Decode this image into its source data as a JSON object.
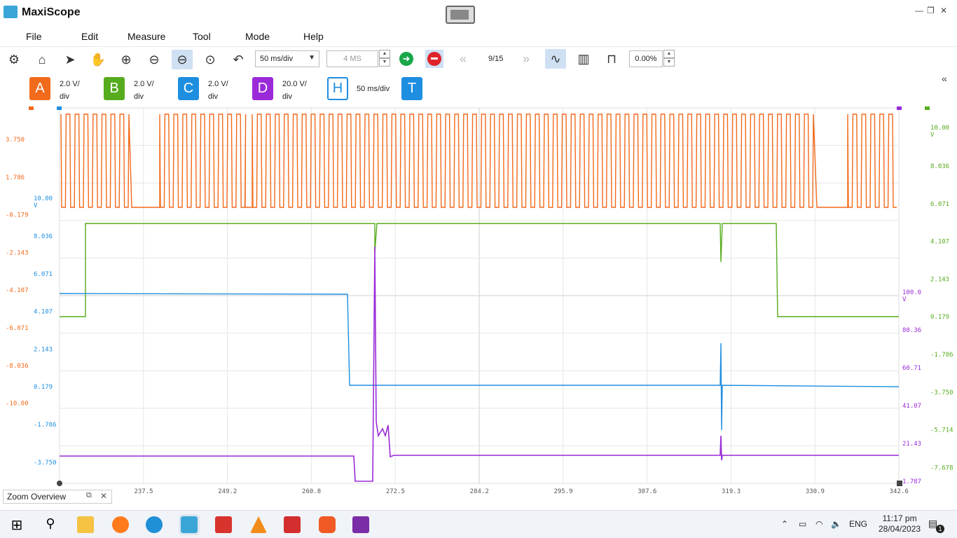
{
  "window": {
    "title": "MaxiScope",
    "min": "—",
    "restore": "❐",
    "close": "✕"
  },
  "menu": {
    "items": [
      {
        "label": "File"
      },
      {
        "label": "Edit"
      },
      {
        "label": "Measure"
      },
      {
        "label": "Tool"
      },
      {
        "label": "Mode"
      },
      {
        "label": "Help"
      }
    ]
  },
  "toolbar": {
    "timebase": "50  ms/div",
    "samples": "4 MS",
    "page": "9/15",
    "percent": "0.00%"
  },
  "channels": [
    {
      "letter": "A",
      "line1": "2.0 V/",
      "line2": "div",
      "color": "#f26a1b"
    },
    {
      "letter": "B",
      "line1": "2.0 V/",
      "line2": "div",
      "color": "#56ac1d"
    },
    {
      "letter": "C",
      "line1": "2.0 V/",
      "line2": "div",
      "color": "#1e8ee0"
    },
    {
      "letter": "D",
      "line1": "20.0 V/",
      "line2": "div",
      "color": "#9a2ad8"
    }
  ],
  "horizontal": {
    "letter": "H",
    "label": "50  ms/div",
    "color": "#1e8ee0"
  },
  "trigger": {
    "letter": "T",
    "color": "#1e8ee0"
  },
  "axes": {
    "orange": [
      "3.750",
      "1.786",
      "-0.179",
      "-2.143",
      "-4.107",
      "-6.071",
      "-8.036",
      "-10.00"
    ],
    "blue_unit": "10.00\nV",
    "blue": [
      "8.036",
      "6.071",
      "4.107",
      "2.143",
      "0.179",
      "-1.786",
      "-3.750"
    ],
    "green_unit": "10.00\nV",
    "green": [
      "8.036",
      "6.071",
      "4.107",
      "2.143",
      "0.179",
      "-1.786",
      "-3.750",
      "-5.714",
      "-7.678"
    ],
    "purple_unit": "100.0\nV",
    "purple": [
      "80.36",
      "60.71",
      "41.07",
      "21.43",
      "1.787"
    ],
    "x": [
      "237.5",
      "249.2",
      "260.8",
      "272.5",
      "284.2",
      "295.9",
      "307.6",
      "319.3",
      "330.9",
      "342.6"
    ]
  },
  "zoom_overview": {
    "label": "Zoom Overview"
  },
  "taskbar": {
    "lang": "ENG",
    "time": "11:17 pm",
    "date": "28/04/2023",
    "notif": "1"
  }
}
